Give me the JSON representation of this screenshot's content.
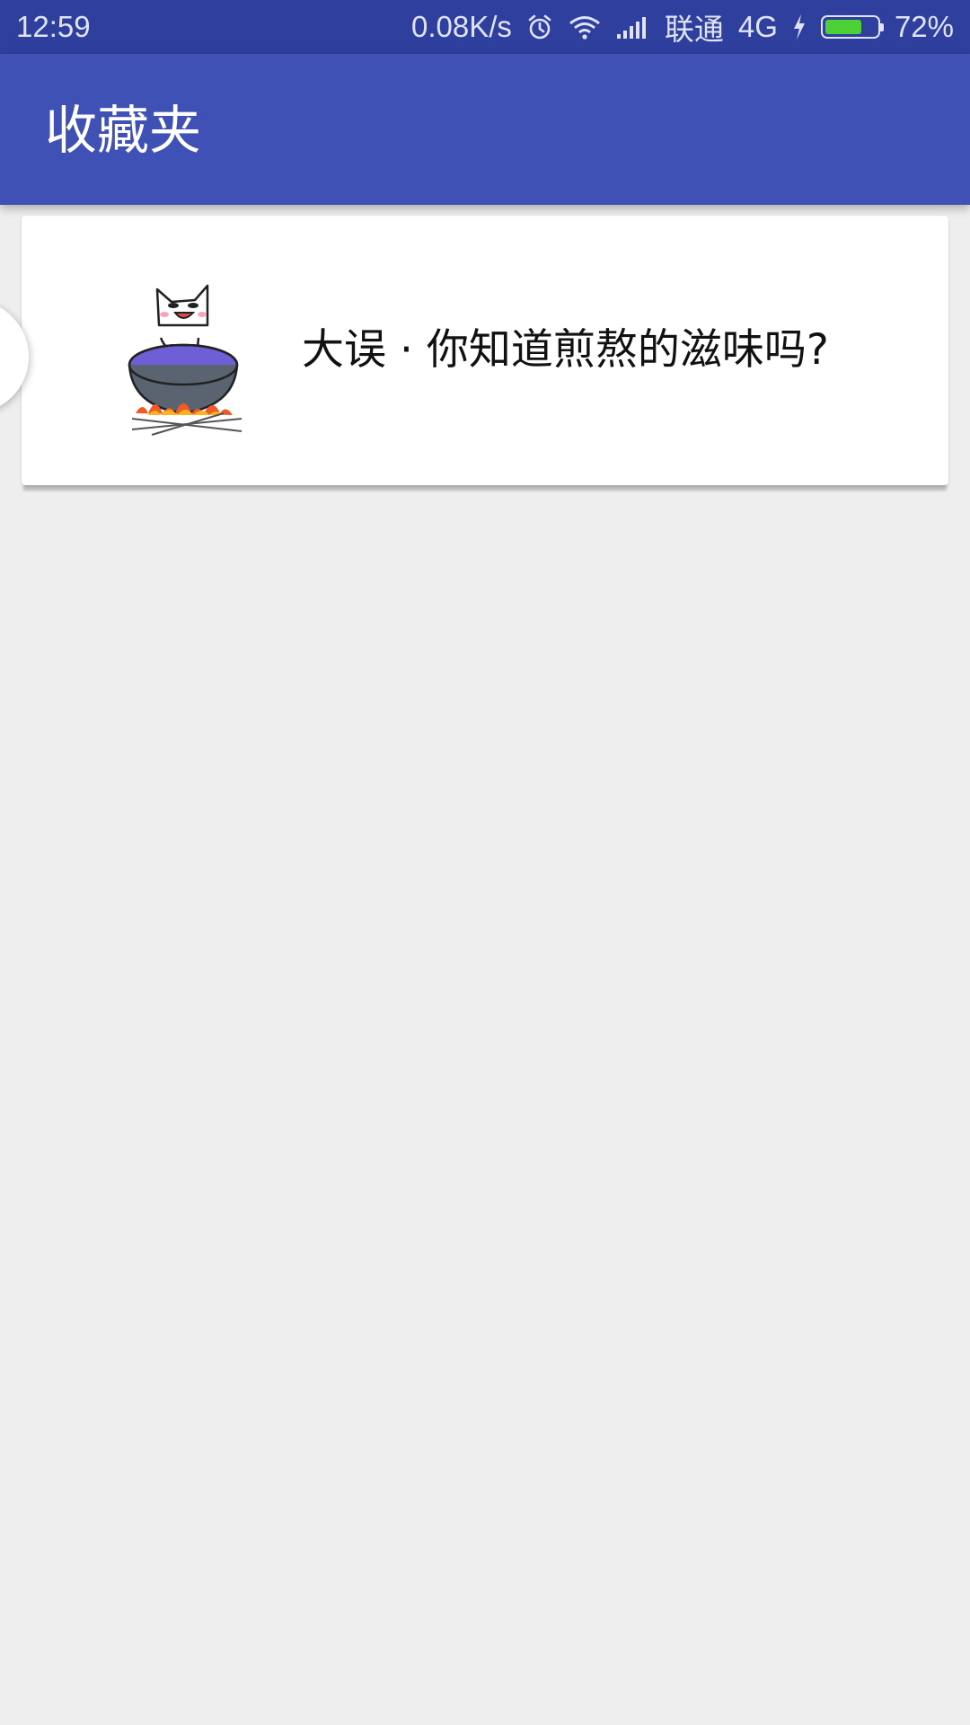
{
  "status_bar": {
    "time": "12:59",
    "net_speed": "0.08K/s",
    "carrier": "联通",
    "network": "4G",
    "battery": "72%",
    "battery_level": 0.72,
    "icons": [
      "alarm-icon",
      "wifi-icon",
      "signal-icon",
      "charging-icon",
      "battery-icon"
    ]
  },
  "app_bar": {
    "title": "收藏夹",
    "color": "#3f51b5"
  },
  "favorites": [
    {
      "title": "大误 · 你知道煎熬的滋味吗?",
      "image": "cat-in-cooking-pot-illustration"
    }
  ],
  "colors": {
    "status_bar": "#2f3f9e",
    "app_bar": "#3f51b5",
    "background": "#eeeeee",
    "card": "#ffffff"
  }
}
